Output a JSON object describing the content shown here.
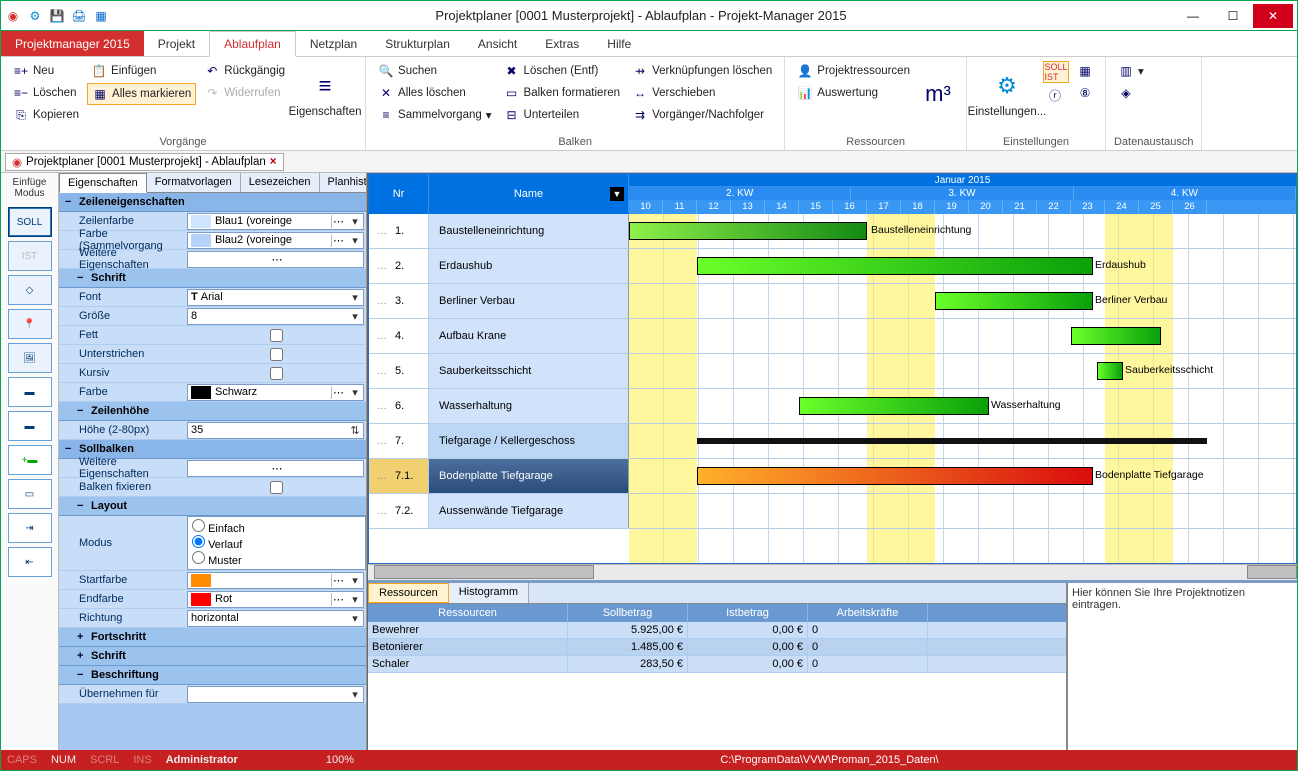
{
  "title": "Projektplaner [0001 Musterprojekt] - Ablaufplan - Projekt-Manager 2015",
  "menu": {
    "brand": "Projektmanager 2015",
    "items": [
      "Projekt",
      "Ablaufplan",
      "Netzplan",
      "Strukturplan",
      "Ansicht",
      "Extras",
      "Hilfe"
    ],
    "active": "Ablaufplan"
  },
  "ribbon": {
    "vorgaenge": {
      "label": "Vorgänge",
      "neu": "Neu",
      "loeschen": "Löschen",
      "kopieren": "Kopieren",
      "einfuegen": "Einfügen",
      "alles_markieren": "Alles markieren",
      "rueckgaengig": "Rückgängig",
      "widerrufen": "Widerrufen",
      "eigenschaften": "Eigenschaften"
    },
    "balken": {
      "label": "Balken",
      "suchen": "Suchen",
      "alles_loeschen": "Alles löschen",
      "sammelvorgang": "Sammelvorgang",
      "loeschen_entf": "Löschen (Entf)",
      "balken_formatieren": "Balken formatieren",
      "unterteilen": "Unterteilen",
      "verknuepfungen_loeschen": "Verknüpfungen löschen",
      "verschieben": "Verschieben",
      "vorgaenger_nachfolger": "Vorgänger/Nachfolger"
    },
    "ressourcen": {
      "label": "Ressourcen",
      "projektressourcen": "Projektressourcen",
      "auswertung": "Auswertung",
      "m3": "m³"
    },
    "einstellungen": {
      "label": "Einstellungen",
      "einstellungen": "Einstellungen..."
    },
    "datenaustausch": {
      "label": "Datenaustausch"
    }
  },
  "doctab": {
    "label": "Projektplaner [0001 Musterprojekt] - Ablaufplan"
  },
  "leftbar": {
    "header": "Einfüge Modus",
    "soll": "SOLL",
    "ist": "IST"
  },
  "props": {
    "tabs": [
      "Eigenschaften",
      "Formatvorlagen",
      "Lesezeichen",
      "Planhistorie"
    ],
    "zeileneig": "Zeileneigenschaften",
    "zeilenfarbe": "Zeilenfarbe",
    "zeilenfarbe_v": "Blau1 (voreinge",
    "farbe_sammel": "Farbe (Sammelvorgang",
    "farbe_sammel_v": "Blau2 (voreinge",
    "weitere": "Weitere Eigenschaften",
    "schrift": "Schrift",
    "font": "Font",
    "font_v": "Arial",
    "groesse": "Größe",
    "groesse_v": "8",
    "fett": "Fett",
    "unterstrichen": "Unterstrichen",
    "kursiv": "Kursiv",
    "farbe": "Farbe",
    "farbe_v": "Schwarz",
    "zeilenhoehe": "Zeilenhöhe",
    "hoehe": "Höhe (2-80px)",
    "hoehe_v": "35",
    "sollbalken": "Sollbalken",
    "balken_fix": "Balken fixieren",
    "layout": "Layout",
    "modus": "Modus",
    "modus_opts": [
      "Einfach",
      "Verlauf",
      "Muster"
    ],
    "modus_sel": "Verlauf",
    "startfarbe": "Startfarbe",
    "startfarbe_v": "Orange",
    "endfarbe": "Endfarbe",
    "endfarbe_v": "Rot",
    "richtung": "Richtung",
    "richtung_v": "horizontal",
    "fortschritt": "Fortschritt",
    "schrift2": "Schrift",
    "beschriftung": "Beschriftung",
    "uebernehmen": "Übernehmen für"
  },
  "gantt": {
    "nr": "Nr",
    "name": "Name",
    "month": "Januar 2015",
    "weeks": [
      "2. KW",
      "3. KW",
      "4. KW"
    ],
    "days": [
      "10",
      "11",
      "12",
      "13",
      "14",
      "15",
      "16",
      "17",
      "18",
      "19",
      "20",
      "21",
      "22",
      "23",
      "24",
      "25",
      "26"
    ],
    "rows": [
      {
        "nr": "1.",
        "name": "Baustelleneinrichtung",
        "bar": {
          "start": 0,
          "len": 238,
          "cls": "g1"
        },
        "lbl": "Baustelleneinrichtung",
        "lblx": 242
      },
      {
        "nr": "2.",
        "name": "Erdaushub",
        "bar": {
          "start": 68,
          "len": 396,
          "cls": "g2"
        },
        "lbl": "Erdaushub",
        "lblx": 466
      },
      {
        "nr": "3.",
        "name": "Berliner Verbau",
        "bar": {
          "start": 306,
          "len": 158,
          "cls": "g2"
        },
        "lbl": "Berliner Verbau",
        "lblx": 466
      },
      {
        "nr": "4.",
        "name": "Aufbau Krane",
        "bar": {
          "start": 442,
          "len": 90,
          "cls": "g2"
        },
        "lbl": "",
        "lblx": 0
      },
      {
        "nr": "5.",
        "name": "Sauberkeitsschicht",
        "bar": {
          "start": 468,
          "len": 26,
          "cls": "g2"
        },
        "lbl": "Sauberkeitsschicht",
        "lblx": 496
      },
      {
        "nr": "6.",
        "name": "Wasserhaltung",
        "bar": {
          "start": 170,
          "len": 190,
          "cls": "g2"
        },
        "lbl": "Wasserhaltung",
        "lblx": 362
      },
      {
        "nr": "7.",
        "name": "Tiefgarage / Kellergeschoss",
        "group": true,
        "bar": {
          "start": 68,
          "len": 510,
          "cls": "sum"
        },
        "lbl": "",
        "lblx": 0
      },
      {
        "nr": "7.1.",
        "name": "Bodenplatte Tiefgarage",
        "sel": true,
        "bar": {
          "start": 68,
          "len": 396,
          "cls": "sel"
        },
        "lbl": "Bodenplatte Tiefgarage",
        "lblx": 466
      },
      {
        "nr": "7.2.",
        "name": "Aussenwände Tiefgarage",
        "bar": null,
        "lbl": "",
        "lblx": 0
      }
    ]
  },
  "res": {
    "tabs": [
      "Ressourcen",
      "Histogramm"
    ],
    "cols": [
      "Ressourcen",
      "Sollbetrag",
      "Istbetrag",
      "Arbeitskräfte"
    ],
    "rows": [
      {
        "name": "Bewehrer",
        "soll": "5.925,00 €",
        "ist": "0,00 €",
        "ak": "0"
      },
      {
        "name": "Betonierer",
        "soll": "1.485,00 €",
        "ist": "0,00 €",
        "ak": "0"
      },
      {
        "name": "Schaler",
        "soll": "283,50 €",
        "ist": "0,00 €",
        "ak": "0"
      }
    ],
    "notes": "Hier können Sie Ihre Projektnotizen eintragen."
  },
  "status": {
    "caps": "CAPS",
    "num": "NUM",
    "scrl": "SCRL",
    "ins": "INS",
    "user": "Administrator",
    "zoom": "100%",
    "path": "C:\\ProgramData\\VVW\\Proman_2015_Daten\\"
  }
}
